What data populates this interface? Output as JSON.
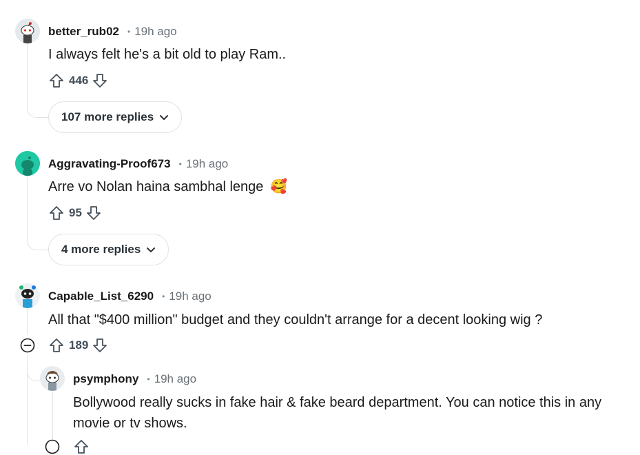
{
  "comments": [
    {
      "author": "better_rub02",
      "time": "19h ago",
      "text": "I always felt he's a bit old to play Ram..",
      "score": "446",
      "more_replies": "107 more replies"
    },
    {
      "author": "Aggravating-Proof673",
      "time": "19h ago",
      "text": "Arre vo Nolan haina sambhal lenge",
      "emoji": "🥰",
      "score": "95",
      "more_replies": "4 more replies"
    },
    {
      "author": "Capable_List_6290",
      "time": "19h ago",
      "text": "All that \"$400 million\" budget and they couldn't arrange for a decent looking wig ?",
      "score": "189"
    }
  ],
  "replies": [
    {
      "author": "psymphony",
      "time": "19h ago",
      "text_line1": "Bollywood really sucks in fake hair & fake beard department. You can notice this in any",
      "text_line2": "movie or tv shows."
    }
  ],
  "separator": "•",
  "icons": [
    "upvote-icon",
    "downvote-icon",
    "chevron-down-icon",
    "collapse-thread-icon",
    "snoo-avatar-icon"
  ],
  "colors": {
    "accent_teal": "#20c9a4",
    "text_primary": "#1a1a1b",
    "meta_gray": "#6a7177",
    "line_gray": "#e0e3e6"
  }
}
